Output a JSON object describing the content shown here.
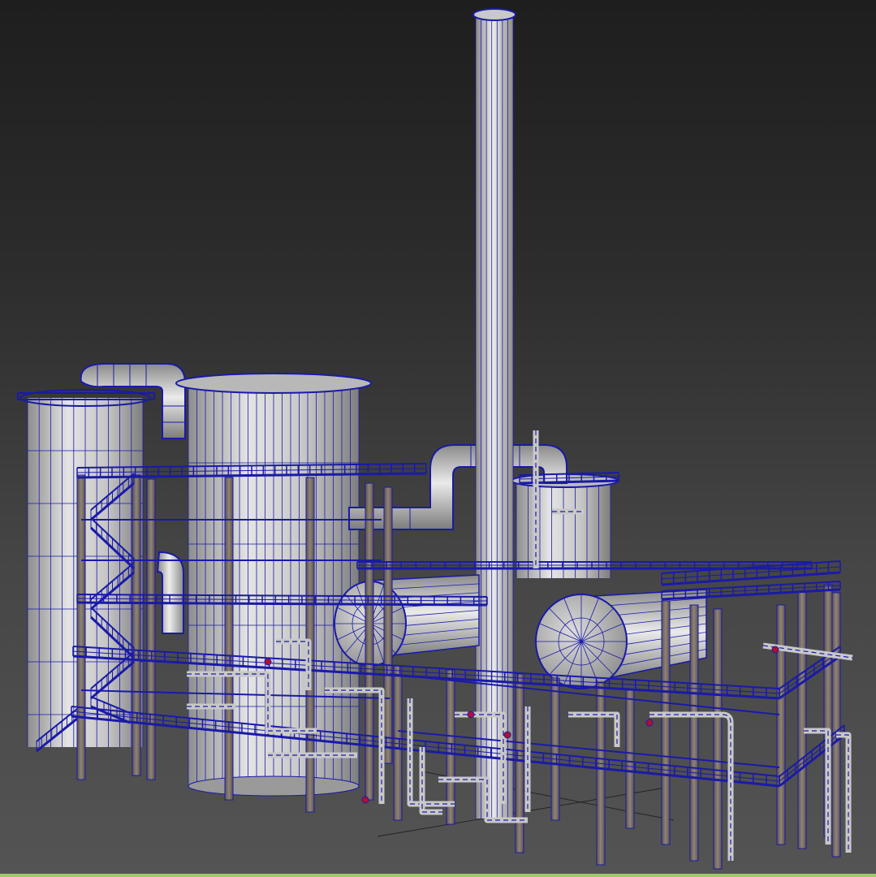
{
  "viewport": {
    "render_mode": "shaded-wireframe",
    "background_top_color": "#1e1e1e",
    "background_bottom_color": "#545454",
    "wire_color": "#1a1aa8",
    "surface_color": "#c8c8c8",
    "column_color": "#7a6f66",
    "valve_color": "#b01030",
    "status_strip_color": "#9ec86a"
  },
  "scene": {
    "objects": [
      "chimney-stack",
      "tall-tank-left",
      "large-storage-tank",
      "small-tank-right",
      "horizontal-vessel-1",
      "horizontal-vessel-2",
      "steel-platform-frame",
      "stair-flights",
      "pipe-network"
    ]
  }
}
